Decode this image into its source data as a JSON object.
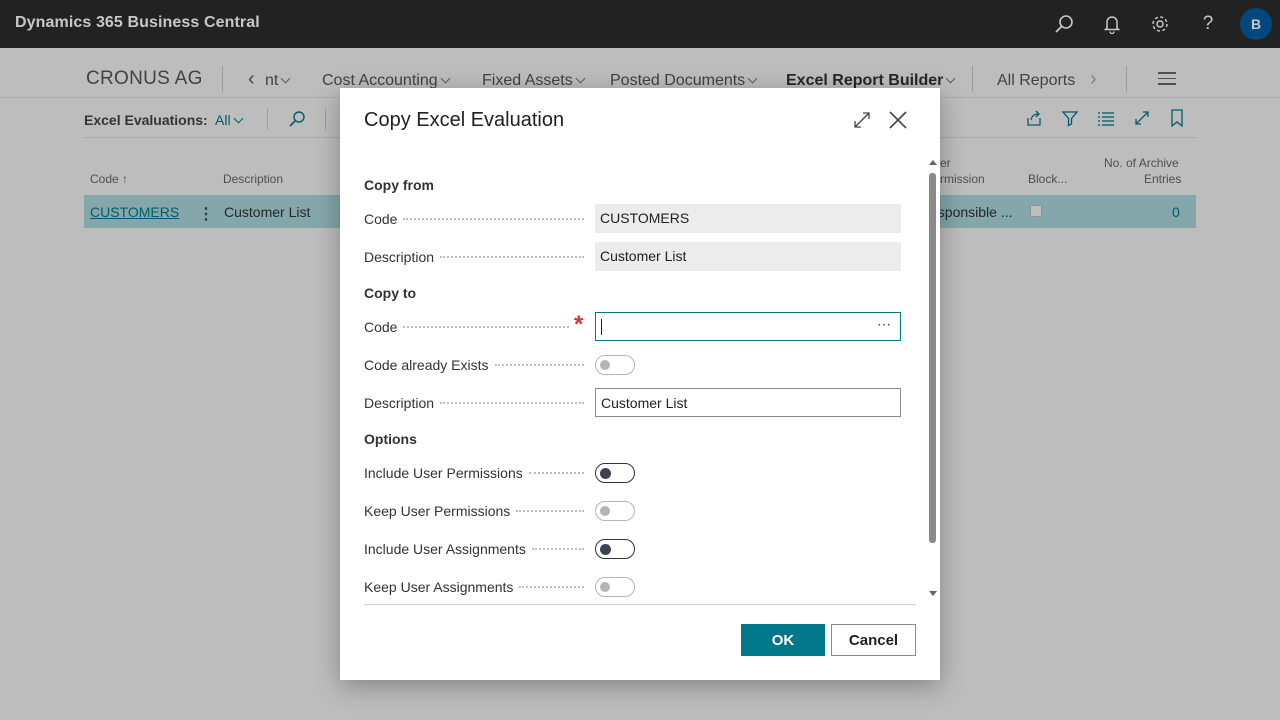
{
  "app": {
    "title": "Dynamics 365 Business Central",
    "avatar_initial": "B"
  },
  "top_icons": [
    "search-icon",
    "bell-icon",
    "gear-icon",
    "help-icon"
  ],
  "nav": {
    "company": "CRONUS AG",
    "back_partial": "nt",
    "items": [
      "Cost Accounting",
      "Fixed Assets",
      "Posted Documents",
      "Excel Report Builder"
    ],
    "all_reports": "All Reports"
  },
  "list": {
    "label": "Excel Evaluations:",
    "filter_value": "All",
    "columns": {
      "code": "Code ↑",
      "description": "Description",
      "user_permission_line1": "er",
      "user_permission_line2": "rmission",
      "blocked": "Block...",
      "archive_line1": "No. of Archive",
      "archive_line2": "Entries"
    },
    "rows": [
      {
        "code": "CUSTOMERS",
        "description": "Customer List",
        "responsible": "esponsible ...",
        "archive_entries": "0"
      }
    ]
  },
  "dialog": {
    "title": "Copy Excel Evaluation",
    "copy_from": {
      "title": "Copy from",
      "code_label": "Code",
      "code_value": "CUSTOMERS",
      "description_label": "Description",
      "description_value": "Customer List"
    },
    "copy_to": {
      "title": "Copy to",
      "code_label": "Code",
      "code_value": "",
      "code_exists_label": "Code already Exists",
      "description_label": "Description",
      "description_value": "Customer List"
    },
    "options": {
      "title": "Options",
      "include_user_permissions": "Include User Permissions",
      "keep_user_permissions": "Keep User Permissions",
      "include_user_assignments": "Include User Assignments",
      "keep_user_assignments": "Keep User Assignments"
    },
    "ok_label": "OK",
    "cancel_label": "Cancel"
  },
  "colors": {
    "accent": "#00788a",
    "appbar": "#2c2c2c",
    "selected_row": "#a8d6db",
    "required": "#d13438"
  }
}
